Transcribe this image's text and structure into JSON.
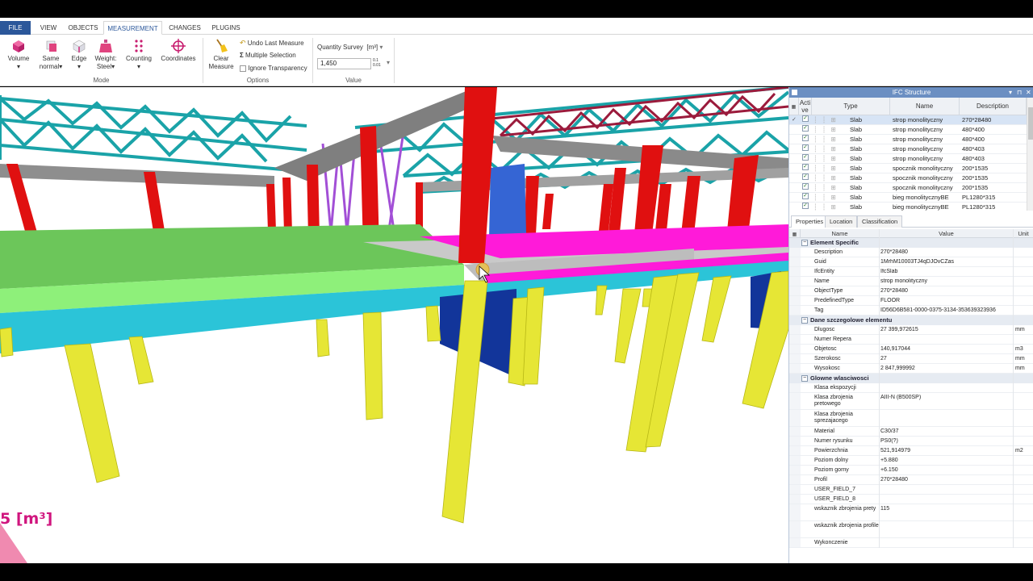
{
  "ribbon": {
    "tabs": [
      "FILE",
      "VIEW",
      "OBJECTS",
      "MEASUREMENT",
      "CHANGES",
      "PLUGINS"
    ],
    "active_tab": "MEASUREMENT",
    "mode": {
      "label": "Mode",
      "volume": "Volume",
      "same": "Same",
      "normal": "normal",
      "edge": "Edge",
      "weight": "Weight:",
      "steel": "Steel",
      "counting": "Counting",
      "coordinates": "Coordinates"
    },
    "options": {
      "label": "Options",
      "clear1": "Clear",
      "clear2": "Measure",
      "undo": "Undo Last Measure",
      "multiple": "Multiple Selection",
      "ignore": "Ignore Transparency"
    },
    "value": {
      "label": "Value",
      "survey": "Quantity Survey",
      "unit": "[m³]",
      "current": "1,450",
      "decimals": "0.1\n0.01"
    }
  },
  "viewport": {
    "measure_readout": "5 [m³]"
  },
  "ifc_panel": {
    "title": "IFC Structure",
    "columns": [
      "Acti\nve",
      "Type",
      "Name",
      "Description"
    ],
    "rows": [
      {
        "type": "Slab",
        "name": "strop monolityczny",
        "desc": "270*28480",
        "selected": true
      },
      {
        "type": "Slab",
        "name": "strop monolityczny",
        "desc": "480*400",
        "selected": false
      },
      {
        "type": "Slab",
        "name": "strop monolityczny",
        "desc": "480*400",
        "selected": false
      },
      {
        "type": "Slab",
        "name": "strop monolityczny",
        "desc": "480*403",
        "selected": false
      },
      {
        "type": "Slab",
        "name": "strop monolityczny",
        "desc": "480*403",
        "selected": false
      },
      {
        "type": "Slab",
        "name": "spocznik monolityczny",
        "desc": "200*1535",
        "selected": false
      },
      {
        "type": "Slab",
        "name": "spocznik monolityczny",
        "desc": "200*1535",
        "selected": false
      },
      {
        "type": "Slab",
        "name": "spocznik monolityczny",
        "desc": "200*1535",
        "selected": false
      },
      {
        "type": "Slab",
        "name": "bieg monolitycznyBE",
        "desc": "PL1280*315",
        "selected": false
      },
      {
        "type": "Slab",
        "name": "bieg monolitycznyBE",
        "desc": "PL1280*315",
        "selected": false
      }
    ]
  },
  "prop_tabs": [
    "Properties",
    "Location",
    "Classification"
  ],
  "props": {
    "columns": [
      "Name",
      "Value",
      "Unit"
    ],
    "groups": [
      {
        "title": "Element Specific",
        "rows": [
          {
            "name": "Description",
            "value": "270*28480",
            "unit": ""
          },
          {
            "name": "Guid",
            "value": "1MrhM10003TJ4qDJOvCZas",
            "unit": ""
          },
          {
            "name": "IfcEntity",
            "value": "IfcSlab",
            "unit": ""
          },
          {
            "name": "Name",
            "value": "strop monolityczny",
            "unit": ""
          },
          {
            "name": "ObjectType",
            "value": "270*28480",
            "unit": ""
          },
          {
            "name": "PredefinedType",
            "value": "FLOOR",
            "unit": ""
          },
          {
            "name": "Tag",
            "value": "ID56D6B581-0000-0375-3134-353639323936",
            "unit": ""
          }
        ]
      },
      {
        "title": "Dane szczegolowe elementu",
        "rows": [
          {
            "name": "Dlugosc",
            "value": "27 399,972615",
            "unit": "mm"
          },
          {
            "name": "Numer Repera",
            "value": "",
            "unit": ""
          },
          {
            "name": "Objetosc",
            "value": "140,917044",
            "unit": "m3"
          },
          {
            "name": "Szerokosc",
            "value": "27",
            "unit": "mm"
          },
          {
            "name": "Wysokosc",
            "value": "2 847,999992",
            "unit": "mm"
          }
        ]
      },
      {
        "title": "Glowne wlasciwosci",
        "rows": [
          {
            "name": "Klasa ekspozycji",
            "value": "",
            "unit": ""
          },
          {
            "name": "Klasa zbrojenia pretowego",
            "value": "AIII-N (B500SP)",
            "unit": "",
            "tall": true
          },
          {
            "name": "Klasa zbrojenia sprezajacego",
            "value": "",
            "unit": "",
            "tall": true
          },
          {
            "name": "Material",
            "value": "C30/37",
            "unit": ""
          },
          {
            "name": "Numer rysunku",
            "value": "PS0(?)",
            "unit": ""
          },
          {
            "name": "Powierzchnia",
            "value": "521,914979",
            "unit": "m2"
          },
          {
            "name": "Poziom dolny",
            "value": "+5.880",
            "unit": ""
          },
          {
            "name": "Poziom gorny",
            "value": "+6.150",
            "unit": ""
          },
          {
            "name": "Profil",
            "value": "270*28480",
            "unit": ""
          },
          {
            "name": "USER_FIELD_7",
            "value": "",
            "unit": ""
          },
          {
            "name": "USER_FIELD_8",
            "value": "",
            "unit": ""
          },
          {
            "name": "wskaznik zbrojenia prety",
            "value": "115",
            "unit": "",
            "tall": true
          },
          {
            "name": "wskaznik zbrojenia profile",
            "value": "",
            "unit": "",
            "tall": true
          },
          {
            "name": "Wykonczenie",
            "value": "",
            "unit": ""
          }
        ]
      }
    ]
  },
  "colors": {
    "accent": "#2b579a",
    "slab_green": "#6cc65a",
    "slab_light": "#8ef07a",
    "slab_cyan": "#2bc4d8",
    "column_yellow": "#e6e635",
    "column_red": "#e01010",
    "selection_magenta": "#ff1ad9",
    "truss_teal": "#1aa3a8"
  }
}
